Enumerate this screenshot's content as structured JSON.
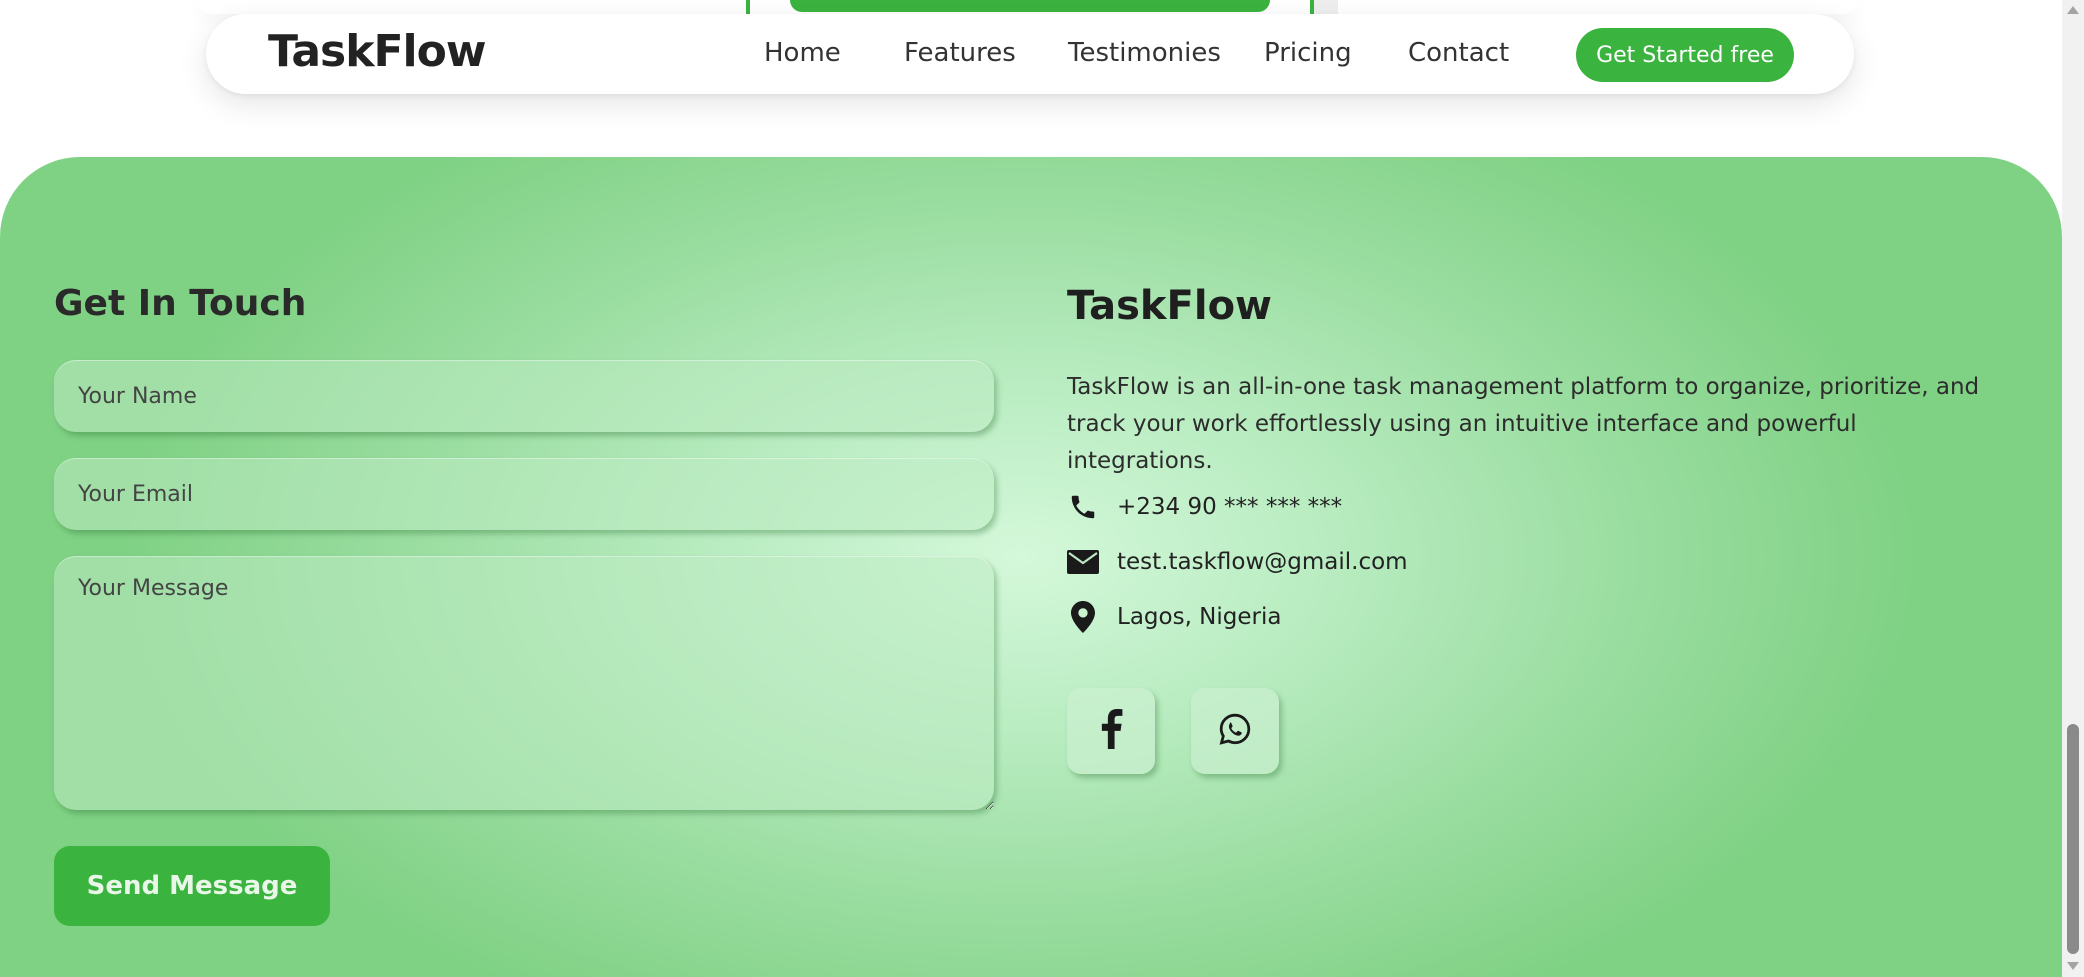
{
  "nav": {
    "logo": "TaskFlow",
    "links": [
      "Home",
      "Features",
      "Testimonies",
      "Pricing",
      "Contact"
    ],
    "cta_label": "Get Started free"
  },
  "contact_form": {
    "title": "Get In Touch",
    "name_placeholder": "Your Name",
    "email_placeholder": "Your Email",
    "message_placeholder": "Your Message",
    "submit_label": "Send Message"
  },
  "info": {
    "title": "TaskFlow",
    "description": "TaskFlow is an all-in-one task management platform to organize, prioritize, and track your work effortlessly using an intuitive interface and powerful integrations.",
    "phone": "+234 90 *** *** ***",
    "email": "test.taskflow@gmail.com",
    "location": "Lagos, Nigeria",
    "socials": [
      "facebook-icon",
      "whatsapp-icon"
    ]
  },
  "colors": {
    "brand_green": "#3bb33f",
    "section_bg_light": "#d4f8da",
    "section_bg_dark": "#7fd184"
  }
}
